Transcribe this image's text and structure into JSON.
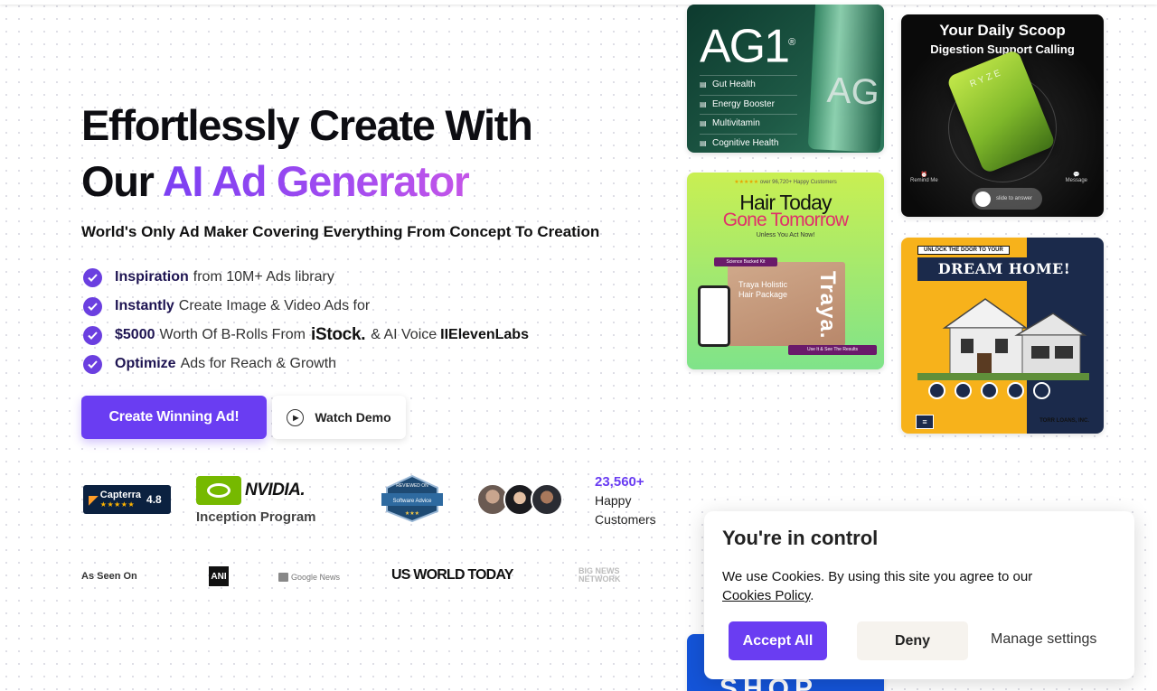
{
  "hero": {
    "title_line1": "Effortlessly Create With",
    "title_line2_prefix": "Our ",
    "title_line2_highlight": "AI Ad Generator",
    "subtitle": "World's Only Ad Maker Covering Everything From Concept To Creation",
    "features": [
      {
        "bold": "Inspiration",
        "text": "from 10M+ Ads library"
      },
      {
        "bold": "Instantly",
        "text": "Create Image & Video Ads for"
      },
      {
        "bold": "$5000",
        "text": "Worth Of B-Rolls From",
        "logo1": "iStock.",
        "text2": "& AI Voice",
        "logo2": "IIElevenLabs"
      },
      {
        "bold": "Optimize",
        "text": "Ads for Reach & Growth"
      }
    ],
    "cta_primary": "Create Winning Ad!",
    "cta_secondary": "Watch Demo"
  },
  "trust": {
    "capterra_name": "Capterra",
    "capterra_stars": "★★★★★",
    "capterra_rating": "4.8",
    "nvidia_word": "NVIDIA.",
    "nvidia_program": "Inception Program",
    "sa_top": "REVIEWED ON",
    "sa_name": "Software Advice",
    "customers_count": "23,560+",
    "customers_line1": "Happy",
    "customers_line2": "Customers"
  },
  "as_seen_on": {
    "label": "As Seen On",
    "ani": "ANI",
    "google_news": "Google News",
    "us_world_today": "US WORLD TODAY",
    "bnn": "BIG NEWS NETWORK"
  },
  "ads": {
    "ag1": {
      "logo": "AG1",
      "reg": "®",
      "bottle_text": "AG",
      "items": [
        "Gut Health",
        "Energy Booster",
        "Multivitamin",
        "Cognitive Health"
      ]
    },
    "scoop": {
      "title": "Your Daily Scoop",
      "subtitle": "Digestion Support Calling",
      "bag_text": "RYZE",
      "remind": "Remind Me",
      "message": "Message",
      "slide": "slide to answer"
    },
    "hair": {
      "top_stars": "★★★★★",
      "top_text": "over 96,720+ Happy Customers",
      "line1": "Hair Today",
      "line2": "Gone Tomorrow",
      "small": "Unless You Act Now!",
      "tag1": "Science Backed Kit",
      "pkg": "Traya Holistic Hair Package",
      "brand": "Traya.",
      "tag2": "Use It & See The Results"
    },
    "dream": {
      "unlock": "UNLOCK THE DOOR TO YOUR",
      "title": "DREAM HOME!",
      "eho": "≡",
      "company": "TORR LOANS, INC."
    },
    "bottom_text": "SHOP"
  },
  "cookie": {
    "title": "You're in control",
    "text": "We use Cookies. By using this site you agree to our ",
    "link": "Cookies Policy",
    "period": ".",
    "accept": "Accept All",
    "deny": "Deny",
    "manage": "Manage settings"
  },
  "colors": {
    "brand": "#6a3df2",
    "gradient_start": "#7b3ff2",
    "gradient_end": "#c455e8",
    "text_dark": "#0d0d12"
  }
}
